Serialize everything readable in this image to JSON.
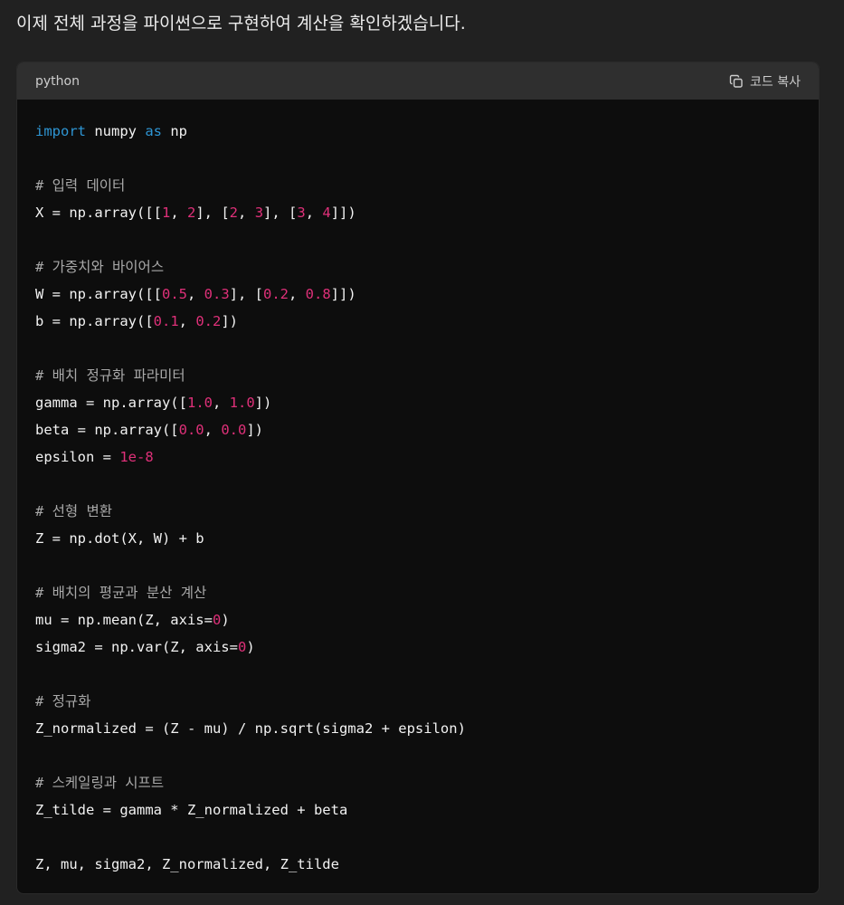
{
  "message": {
    "intro_text": "이제 전체 과정을 파이썬으로 구현하여 계산을 확인하겠습니다."
  },
  "code_block": {
    "language": "python",
    "copy_label": "코드 복사",
    "copy_icon": "copy-icon",
    "colors": {
      "keyword": "#2e95d3",
      "number": "#df3079",
      "comment": "#a9a9a9",
      "plain": "#f2f2f2"
    },
    "lines": [
      [
        {
          "t": "kw",
          "v": "import"
        },
        {
          "t": "pl",
          "v": " numpy "
        },
        {
          "t": "kw",
          "v": "as"
        },
        {
          "t": "pl",
          "v": " np"
        }
      ],
      [],
      [
        {
          "t": "cm",
          "v": "# 입력 데이터"
        }
      ],
      [
        {
          "t": "pl",
          "v": "X = np.array([["
        },
        {
          "t": "num",
          "v": "1"
        },
        {
          "t": "pl",
          "v": ", "
        },
        {
          "t": "num",
          "v": "2"
        },
        {
          "t": "pl",
          "v": "], ["
        },
        {
          "t": "num",
          "v": "2"
        },
        {
          "t": "pl",
          "v": ", "
        },
        {
          "t": "num",
          "v": "3"
        },
        {
          "t": "pl",
          "v": "], ["
        },
        {
          "t": "num",
          "v": "3"
        },
        {
          "t": "pl",
          "v": ", "
        },
        {
          "t": "num",
          "v": "4"
        },
        {
          "t": "pl",
          "v": "]])"
        }
      ],
      [],
      [
        {
          "t": "cm",
          "v": "# 가중치와 바이어스"
        }
      ],
      [
        {
          "t": "pl",
          "v": "W = np.array([["
        },
        {
          "t": "num",
          "v": "0.5"
        },
        {
          "t": "pl",
          "v": ", "
        },
        {
          "t": "num",
          "v": "0.3"
        },
        {
          "t": "pl",
          "v": "], ["
        },
        {
          "t": "num",
          "v": "0.2"
        },
        {
          "t": "pl",
          "v": ", "
        },
        {
          "t": "num",
          "v": "0.8"
        },
        {
          "t": "pl",
          "v": "]])"
        }
      ],
      [
        {
          "t": "pl",
          "v": "b = np.array(["
        },
        {
          "t": "num",
          "v": "0.1"
        },
        {
          "t": "pl",
          "v": ", "
        },
        {
          "t": "num",
          "v": "0.2"
        },
        {
          "t": "pl",
          "v": "])"
        }
      ],
      [],
      [
        {
          "t": "cm",
          "v": "# 배치 정규화 파라미터"
        }
      ],
      [
        {
          "t": "pl",
          "v": "gamma = np.array(["
        },
        {
          "t": "num",
          "v": "1.0"
        },
        {
          "t": "pl",
          "v": ", "
        },
        {
          "t": "num",
          "v": "1.0"
        },
        {
          "t": "pl",
          "v": "])"
        }
      ],
      [
        {
          "t": "pl",
          "v": "beta = np.array(["
        },
        {
          "t": "num",
          "v": "0.0"
        },
        {
          "t": "pl",
          "v": ", "
        },
        {
          "t": "num",
          "v": "0.0"
        },
        {
          "t": "pl",
          "v": "])"
        }
      ],
      [
        {
          "t": "pl",
          "v": "epsilon = "
        },
        {
          "t": "num",
          "v": "1e-8"
        }
      ],
      [],
      [
        {
          "t": "cm",
          "v": "# 선형 변환"
        }
      ],
      [
        {
          "t": "pl",
          "v": "Z = np.dot(X, W) + b"
        }
      ],
      [],
      [
        {
          "t": "cm",
          "v": "# 배치의 평균과 분산 계산"
        }
      ],
      [
        {
          "t": "pl",
          "v": "mu = np.mean(Z, axis="
        },
        {
          "t": "num",
          "v": "0"
        },
        {
          "t": "pl",
          "v": ")"
        }
      ],
      [
        {
          "t": "pl",
          "v": "sigma2 = np.var(Z, axis="
        },
        {
          "t": "num",
          "v": "0"
        },
        {
          "t": "pl",
          "v": ")"
        }
      ],
      [],
      [
        {
          "t": "cm",
          "v": "# 정규화"
        }
      ],
      [
        {
          "t": "pl",
          "v": "Z_normalized = (Z - mu) / np.sqrt(sigma2 + epsilon)"
        }
      ],
      [],
      [
        {
          "t": "cm",
          "v": "# 스케일링과 시프트"
        }
      ],
      [
        {
          "t": "pl",
          "v": "Z_tilde = gamma * Z_normalized + beta"
        }
      ],
      [],
      [
        {
          "t": "pl",
          "v": "Z, mu, sigma2, Z_normalized, Z_tilde"
        }
      ]
    ]
  }
}
